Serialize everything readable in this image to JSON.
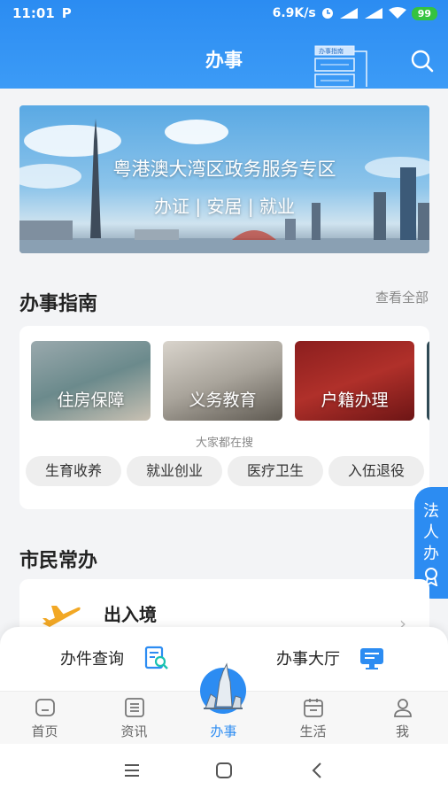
{
  "status_bar": {
    "time": "11:01",
    "app_icon": "P",
    "speed": "6.9K/s",
    "battery": "99"
  },
  "header": {
    "title": "办事",
    "guide_badge": "办事指南"
  },
  "banner": {
    "title": "粤港澳大湾区政务服务专区",
    "subtitle": "办证 | 安居 | 就业"
  },
  "guide": {
    "title": "办事指南",
    "see_all": "查看全部",
    "tiles": [
      {
        "label": "住房保障"
      },
      {
        "label": "义务教育"
      },
      {
        "label": "户籍办理"
      }
    ],
    "hot_label": "大家都在搜",
    "chips": [
      "生育收养",
      "就业创业",
      "医疗卫生",
      "入伍退役"
    ]
  },
  "legal_tab": {
    "label": "法人办"
  },
  "citizen": {
    "title": "市民常办",
    "item": "出入境"
  },
  "quick_actions": [
    {
      "label": "办件查询",
      "icon": "document-search-icon"
    },
    {
      "label": "办事大厅",
      "icon": "monitor-hall-icon"
    }
  ],
  "tabbar": {
    "items": [
      {
        "label": "首页",
        "icon": "home-icon"
      },
      {
        "label": "资讯",
        "icon": "news-icon"
      },
      {
        "label": "办事",
        "icon": "goat-emblem-icon"
      },
      {
        "label": "生活",
        "icon": "calendar-icon"
      },
      {
        "label": "我",
        "icon": "user-icon"
      }
    ],
    "active": "办事"
  },
  "colors": {
    "primary": "#2c8cf2",
    "header_top": "#2b8cf2",
    "battery": "#35c33f"
  }
}
